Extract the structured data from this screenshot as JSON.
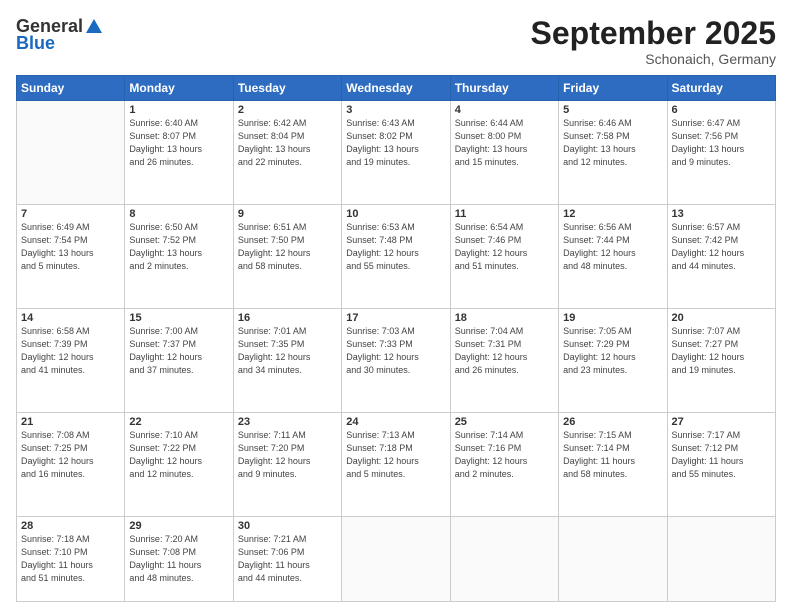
{
  "logo": {
    "general": "General",
    "blue": "Blue"
  },
  "header": {
    "month": "September 2025",
    "location": "Schonaich, Germany"
  },
  "weekdays": [
    "Sunday",
    "Monday",
    "Tuesday",
    "Wednesday",
    "Thursday",
    "Friday",
    "Saturday"
  ],
  "weeks": [
    [
      {
        "day": "",
        "info": ""
      },
      {
        "day": "1",
        "info": "Sunrise: 6:40 AM\nSunset: 8:07 PM\nDaylight: 13 hours\nand 26 minutes."
      },
      {
        "day": "2",
        "info": "Sunrise: 6:42 AM\nSunset: 8:04 PM\nDaylight: 13 hours\nand 22 minutes."
      },
      {
        "day": "3",
        "info": "Sunrise: 6:43 AM\nSunset: 8:02 PM\nDaylight: 13 hours\nand 19 minutes."
      },
      {
        "day": "4",
        "info": "Sunrise: 6:44 AM\nSunset: 8:00 PM\nDaylight: 13 hours\nand 15 minutes."
      },
      {
        "day": "5",
        "info": "Sunrise: 6:46 AM\nSunset: 7:58 PM\nDaylight: 13 hours\nand 12 minutes."
      },
      {
        "day": "6",
        "info": "Sunrise: 6:47 AM\nSunset: 7:56 PM\nDaylight: 13 hours\nand 9 minutes."
      }
    ],
    [
      {
        "day": "7",
        "info": "Sunrise: 6:49 AM\nSunset: 7:54 PM\nDaylight: 13 hours\nand 5 minutes."
      },
      {
        "day": "8",
        "info": "Sunrise: 6:50 AM\nSunset: 7:52 PM\nDaylight: 13 hours\nand 2 minutes."
      },
      {
        "day": "9",
        "info": "Sunrise: 6:51 AM\nSunset: 7:50 PM\nDaylight: 12 hours\nand 58 minutes."
      },
      {
        "day": "10",
        "info": "Sunrise: 6:53 AM\nSunset: 7:48 PM\nDaylight: 12 hours\nand 55 minutes."
      },
      {
        "day": "11",
        "info": "Sunrise: 6:54 AM\nSunset: 7:46 PM\nDaylight: 12 hours\nand 51 minutes."
      },
      {
        "day": "12",
        "info": "Sunrise: 6:56 AM\nSunset: 7:44 PM\nDaylight: 12 hours\nand 48 minutes."
      },
      {
        "day": "13",
        "info": "Sunrise: 6:57 AM\nSunset: 7:42 PM\nDaylight: 12 hours\nand 44 minutes."
      }
    ],
    [
      {
        "day": "14",
        "info": "Sunrise: 6:58 AM\nSunset: 7:39 PM\nDaylight: 12 hours\nand 41 minutes."
      },
      {
        "day": "15",
        "info": "Sunrise: 7:00 AM\nSunset: 7:37 PM\nDaylight: 12 hours\nand 37 minutes."
      },
      {
        "day": "16",
        "info": "Sunrise: 7:01 AM\nSunset: 7:35 PM\nDaylight: 12 hours\nand 34 minutes."
      },
      {
        "day": "17",
        "info": "Sunrise: 7:03 AM\nSunset: 7:33 PM\nDaylight: 12 hours\nand 30 minutes."
      },
      {
        "day": "18",
        "info": "Sunrise: 7:04 AM\nSunset: 7:31 PM\nDaylight: 12 hours\nand 26 minutes."
      },
      {
        "day": "19",
        "info": "Sunrise: 7:05 AM\nSunset: 7:29 PM\nDaylight: 12 hours\nand 23 minutes."
      },
      {
        "day": "20",
        "info": "Sunrise: 7:07 AM\nSunset: 7:27 PM\nDaylight: 12 hours\nand 19 minutes."
      }
    ],
    [
      {
        "day": "21",
        "info": "Sunrise: 7:08 AM\nSunset: 7:25 PM\nDaylight: 12 hours\nand 16 minutes."
      },
      {
        "day": "22",
        "info": "Sunrise: 7:10 AM\nSunset: 7:22 PM\nDaylight: 12 hours\nand 12 minutes."
      },
      {
        "day": "23",
        "info": "Sunrise: 7:11 AM\nSunset: 7:20 PM\nDaylight: 12 hours\nand 9 minutes."
      },
      {
        "day": "24",
        "info": "Sunrise: 7:13 AM\nSunset: 7:18 PM\nDaylight: 12 hours\nand 5 minutes."
      },
      {
        "day": "25",
        "info": "Sunrise: 7:14 AM\nSunset: 7:16 PM\nDaylight: 12 hours\nand 2 minutes."
      },
      {
        "day": "26",
        "info": "Sunrise: 7:15 AM\nSunset: 7:14 PM\nDaylight: 11 hours\nand 58 minutes."
      },
      {
        "day": "27",
        "info": "Sunrise: 7:17 AM\nSunset: 7:12 PM\nDaylight: 11 hours\nand 55 minutes."
      }
    ],
    [
      {
        "day": "28",
        "info": "Sunrise: 7:18 AM\nSunset: 7:10 PM\nDaylight: 11 hours\nand 51 minutes."
      },
      {
        "day": "29",
        "info": "Sunrise: 7:20 AM\nSunset: 7:08 PM\nDaylight: 11 hours\nand 48 minutes."
      },
      {
        "day": "30",
        "info": "Sunrise: 7:21 AM\nSunset: 7:06 PM\nDaylight: 11 hours\nand 44 minutes."
      },
      {
        "day": "",
        "info": ""
      },
      {
        "day": "",
        "info": ""
      },
      {
        "day": "",
        "info": ""
      },
      {
        "day": "",
        "info": ""
      }
    ]
  ]
}
